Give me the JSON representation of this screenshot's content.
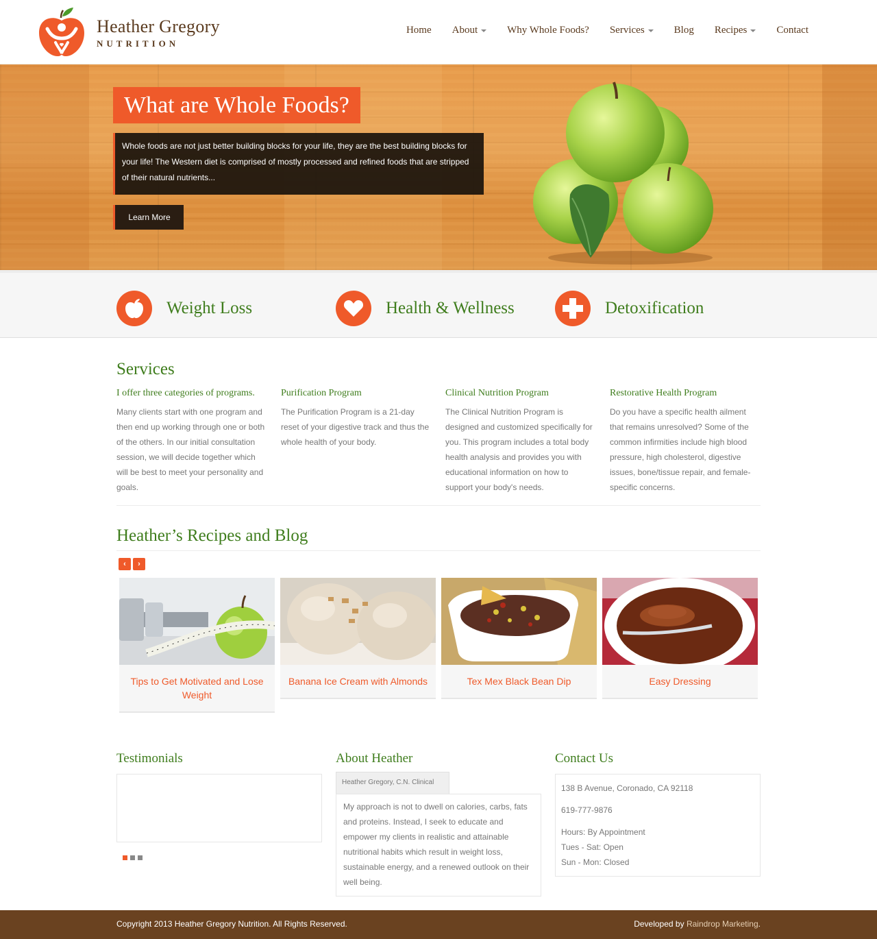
{
  "brand": {
    "name": "Heather Gregory",
    "sub": "NUTRITION"
  },
  "nav": {
    "home": "Home",
    "about": "About",
    "why": "Why Whole Foods?",
    "services": "Services",
    "blog": "Blog",
    "recipes": "Recipes",
    "contact": "Contact"
  },
  "hero": {
    "title": "What are Whole Foods?",
    "text": "Whole foods are not just better building blocks for your life, they are the best building blocks for your life! The Western diet is comprised of mostly processed and refined foods that are stripped of their natural nutrients...",
    "button": "Learn More"
  },
  "features": [
    {
      "label": "Weight Loss",
      "icon": "apple-icon"
    },
    {
      "label": "Health & Wellness",
      "icon": "heart-icon"
    },
    {
      "label": "Detoxification",
      "icon": "cross-icon"
    }
  ],
  "services": {
    "title": "Services",
    "items": [
      {
        "title": "I offer three categories of programs.",
        "body": "Many clients start with one program and then end up working through one or both of the others. In our initial consultation session, we will decide together which will be best to meet your personality and goals."
      },
      {
        "title": "Purification Program",
        "body": "The Purification Program is a 21-day reset of your digestive track and thus the whole health of your body."
      },
      {
        "title": "Clinical Nutrition Program",
        "body": "The Clinical Nutrition Program is designed and customized specifically for you. This program includes a total body health analysis and provides you with educational information on how to support your body's needs."
      },
      {
        "title": "Restorative Health Program",
        "body": "Do you have a specific health ailment that remains unresolved? Some of the common infirmities include high blood pressure, high cholesterol, digestive issues, bone/tissue repair, and female-specific concerns."
      }
    ]
  },
  "blog": {
    "title": "Heather’s Recipes and Blog",
    "cards": [
      {
        "label": "Tips to Get Motivated and Lose Weight"
      },
      {
        "label": "Banana Ice Cream with Almonds"
      },
      {
        "label": "Tex Mex Black Bean Dip"
      },
      {
        "label": "Easy Dressing"
      }
    ]
  },
  "testimonials": {
    "title": "Testimonials"
  },
  "about": {
    "title": "About Heather",
    "tab": "Heather Gregory, C.N. Clinical",
    "body": "My approach is not to dwell on calories, carbs, fats and proteins. Instead, I seek to educate and empower my clients in realistic and attainable nutritional habits which result in weight loss, sustainable energy, and a renewed outlook on their well being."
  },
  "contact": {
    "title": "Contact Us",
    "address": "138 B Avenue, Coronado, CA 92118",
    "phone": "619-777-9876",
    "hours": "Hours: By Appointment",
    "tue_sat": "Tues - Sat: Open",
    "sun_mon": "Sun - Mon: Closed"
  },
  "footer": {
    "copyright": "Copyright 2013 Heather Gregory Nutrition. All Rights Reserved.",
    "developed_prefix": "Developed by",
    "developer": "Raindrop Marketing",
    "developed_suffix": "."
  },
  "colors": {
    "accent": "#ef5a2a",
    "green": "#3f7d1d",
    "brown": "#6a4220"
  }
}
